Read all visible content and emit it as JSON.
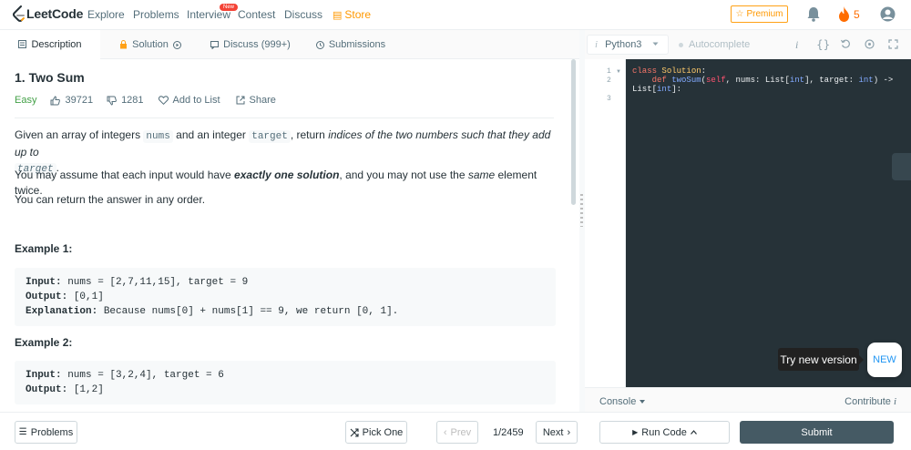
{
  "nav": {
    "logo": "LeetCode",
    "links": [
      "Explore",
      "Problems",
      "Interview",
      "Contest",
      "Discuss"
    ],
    "store": "Store",
    "new_badge": "New",
    "premium": "Premium",
    "streak": "5",
    "accent": "#ffa116"
  },
  "tabs": [
    {
      "label": "Description"
    },
    {
      "label": "Solution"
    },
    {
      "label": "Discuss (999+)"
    },
    {
      "label": "Submissions"
    }
  ],
  "problem": {
    "title": "1. Two Sum",
    "difficulty": "Easy",
    "likes": "39721",
    "dislikes": "1281",
    "add_to_list": "Add to List",
    "share": "Share",
    "p1_a": "Given an array of integers ",
    "p1_code1": "nums",
    "p1_b": " and an integer ",
    "p1_code2": "target",
    "p1_c": ", return ",
    "p1_em": "indices of the two numbers such that they add up to",
    "p1_code3": "target",
    "p1_d": ".",
    "p2_a": "You may assume that each input would have ",
    "p2_strong": "exactly one solution",
    "p2_b": ", and you may not use the ",
    "p2_em": "same",
    "p2_c": " element twice.",
    "p3": "You can return the answer in any order.",
    "examples": [
      {
        "heading": "Example 1:",
        "input_label": "Input:",
        "input": " nums = [2,7,11,15], target = 9",
        "output_label": "Output:",
        "output": " [0,1]",
        "explanation_label": "Explanation:",
        "explanation": " Because nums[0] + nums[1] == 9, we return [0, 1]."
      },
      {
        "heading": "Example 2:",
        "input_label": "Input:",
        "input": " nums = [3,2,4], target = 6",
        "output_label": "Output:",
        "output": " [1,2]"
      }
    ]
  },
  "editor": {
    "language": "Python3",
    "autocomplete": "Autocomplete",
    "line_numbers": [
      "1",
      "2",
      "3"
    ],
    "code": {
      "l1_kw": "class",
      "l1_cls": "Solution",
      "l1_colon": ":",
      "l2_indent": "    ",
      "l2_kw": "def",
      "l2_fn": "twoSum",
      "l2_open": "(",
      "l2_self": "self",
      "l2_a": ", nums: List[",
      "l2_t1": "int",
      "l2_b": "], target: ",
      "l2_t2": "int",
      "l2_c": ") ->",
      "l3_a": "List[",
      "l3_t": "int",
      "l3_b": "]:"
    },
    "try_new": "Try new version",
    "new_label": "NEW"
  },
  "console": {
    "console_label": "Console",
    "contribute": "Contribute"
  },
  "footer": {
    "problems": "Problems",
    "pick_one": "Pick One",
    "prev": "Prev",
    "page": "1/2459",
    "next": "Next",
    "run_code": "Run Code",
    "submit": "Submit"
  }
}
